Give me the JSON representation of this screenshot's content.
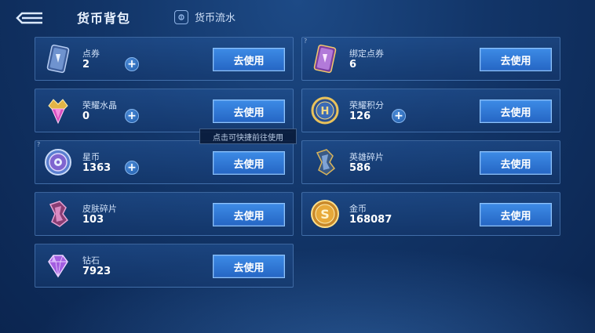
{
  "header": {
    "back_icon": "back-arrow-icon",
    "title": "货币背包",
    "flow_tab_label": "货币流水",
    "flow_icon": "ledger-icon"
  },
  "tooltip": "点击可快捷前往使用",
  "colors": {
    "background": "#123568",
    "card_border": "#6ea0dc",
    "button": "#2f77d6",
    "plus": "#2f6fc0"
  },
  "currencies": [
    {
      "name": "点券",
      "amount": "2",
      "icon": "voucher-card-icon",
      "has_plus": true,
      "help_mark": false,
      "button_label": "去使用"
    },
    {
      "name": "绑定点券",
      "amount": "6",
      "icon": "bound-voucher-card-icon",
      "has_plus": false,
      "help_mark": true,
      "button_label": "去使用"
    },
    {
      "name": "荣耀水晶",
      "amount": "0",
      "icon": "glory-crystal-icon",
      "has_plus": true,
      "help_mark": false,
      "button_label": "去使用"
    },
    {
      "name": "荣耀积分",
      "amount": "126",
      "icon": "glory-points-icon",
      "has_plus": true,
      "help_mark": false,
      "button_label": "去使用"
    },
    {
      "name": "星币",
      "amount": "1363",
      "icon": "star-coin-icon",
      "has_plus": true,
      "help_mark": true,
      "button_label": "去使用"
    },
    {
      "name": "英雄碎片",
      "amount": "586",
      "icon": "hero-fragment-icon",
      "has_plus": false,
      "help_mark": false,
      "button_label": "去使用"
    },
    {
      "name": "皮肤碎片",
      "amount": "103",
      "icon": "skin-fragment-icon",
      "has_plus": false,
      "help_mark": false,
      "button_label": "去使用"
    },
    {
      "name": "金币",
      "amount": "168087",
      "icon": "gold-coin-icon",
      "has_plus": false,
      "help_mark": false,
      "button_label": "去使用"
    },
    {
      "name": "钻石",
      "amount": "7923",
      "icon": "diamond-icon",
      "has_plus": false,
      "help_mark": false,
      "button_label": "去使用"
    }
  ]
}
